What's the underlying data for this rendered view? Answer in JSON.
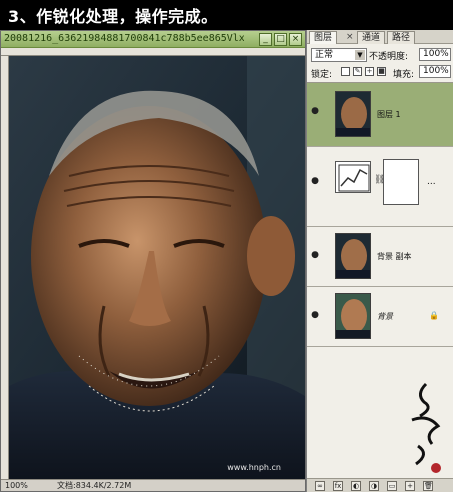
{
  "caption": "3、作锐化处理，操作完成。",
  "document": {
    "title": "20081216_63621984881700841c788b5ee865Vlxr.jp...",
    "buttons": [
      "_",
      "□",
      "×"
    ],
    "zoom": "100%",
    "status": "文档:834.4K/2.72M",
    "watermark": "www.hnph.cn"
  },
  "panel": {
    "tabs": [
      "图层",
      "通道",
      "路径"
    ],
    "blend_mode": "正常",
    "opacity_label": "不透明度:",
    "opacity_value": "100%",
    "lock_label": "锁定:",
    "fill_label": "填充:",
    "fill_value": "100%",
    "layers": [
      {
        "name": "图层 1",
        "active": true,
        "visible": true
      },
      {
        "name": "",
        "active": false,
        "visible": true,
        "type": "adjustment"
      },
      {
        "name": "背景 副本",
        "active": false,
        "visible": true
      },
      {
        "name": "背景",
        "active": false,
        "visible": true,
        "locked": true
      }
    ],
    "ellipsis": "..."
  },
  "icons": [
    "eye-icon",
    "lock-icon",
    "chain-icon",
    "close-icon",
    "dropdown-arrow-icon"
  ],
  "colors": {
    "titlebar_green": "#8fae62",
    "active_layer": "#9aae76",
    "panel_bg": "#f1efe8"
  }
}
